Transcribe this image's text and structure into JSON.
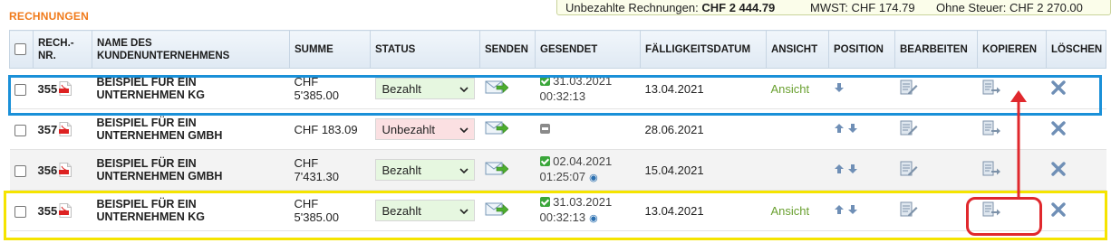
{
  "section": {
    "title": "RECHNUNGEN"
  },
  "summary": {
    "unpaid_label": "Unbezahlte Rechnungen:",
    "unpaid_value": "CHF 2 444.79",
    "vat_label": "MWST:",
    "vat_value": "CHF 174.79",
    "net_label": "Ohne Steuer:",
    "net_value": "CHF 2 270.00"
  },
  "headers": {
    "number": "RECH.-NR.",
    "customer": "NAME DES KUNDENUNTERNEHMENS",
    "sum": "SUMME",
    "status": "STATUS",
    "send": "SENDEN",
    "sent": "GESENDET",
    "due": "FÄLLIGKEITSDATUM",
    "view": "ANSICHT",
    "position": "POSITION",
    "edit": "BEARBEITEN",
    "copy": "KOPIEREN",
    "delete": "LÖSCHEN"
  },
  "rows": [
    {
      "number": "355",
      "customer": "BEISPIEL FÜR EIN UNTERNEHMEN KG",
      "sum": "CHF 5'385.00",
      "status": "Bezahlt",
      "sent_date": "31.03.2021",
      "sent_time": "00:32:13",
      "due": "13.04.2021",
      "view": "Ansicht"
    },
    {
      "number": "357",
      "customer": "BEISPIEL FÜR EIN UNTERNEHMEN GMBH",
      "sum": "CHF 183.09",
      "status": "Unbezahlt",
      "sent_date": "",
      "sent_time": "",
      "due": "28.06.2021",
      "view": ""
    },
    {
      "number": "356",
      "customer": "BEISPIEL FÜR EIN UNTERNEHMEN GMBH",
      "sum": "CHF 7'431.30",
      "status": "Bezahlt",
      "sent_date": "02.04.2021",
      "sent_time": "01:25:07",
      "due": "15.04.2021",
      "view": ""
    },
    {
      "number": "355",
      "customer": "BEISPIEL FÜR EIN UNTERNEHMEN KG",
      "sum": "CHF 5'385.00",
      "status": "Bezahlt",
      "sent_date": "31.03.2021",
      "sent_time": "00:32:13",
      "due": "13.04.2021",
      "view": "Ansicht"
    }
  ],
  "colors": {
    "title_orange": "#f07a1a",
    "paid_bg": "#e6f7e0",
    "unpaid_bg": "#fbe0e2",
    "view_green": "#6aa030",
    "highlight_blue": "#1a90d8",
    "highlight_yellow": "#f5e400",
    "highlight_red": "#e0282d"
  },
  "icons": {
    "pdf": "pdf-icon",
    "send": "send-mail-icon",
    "sent_ok": "check-icon",
    "sent_pending": "pending-icon",
    "viewed": "eye-icon",
    "position_up": "arrow-up-icon",
    "position_down": "arrow-down-icon",
    "edit": "edit-icon",
    "copy": "copy-icon",
    "delete": "delete-icon"
  }
}
